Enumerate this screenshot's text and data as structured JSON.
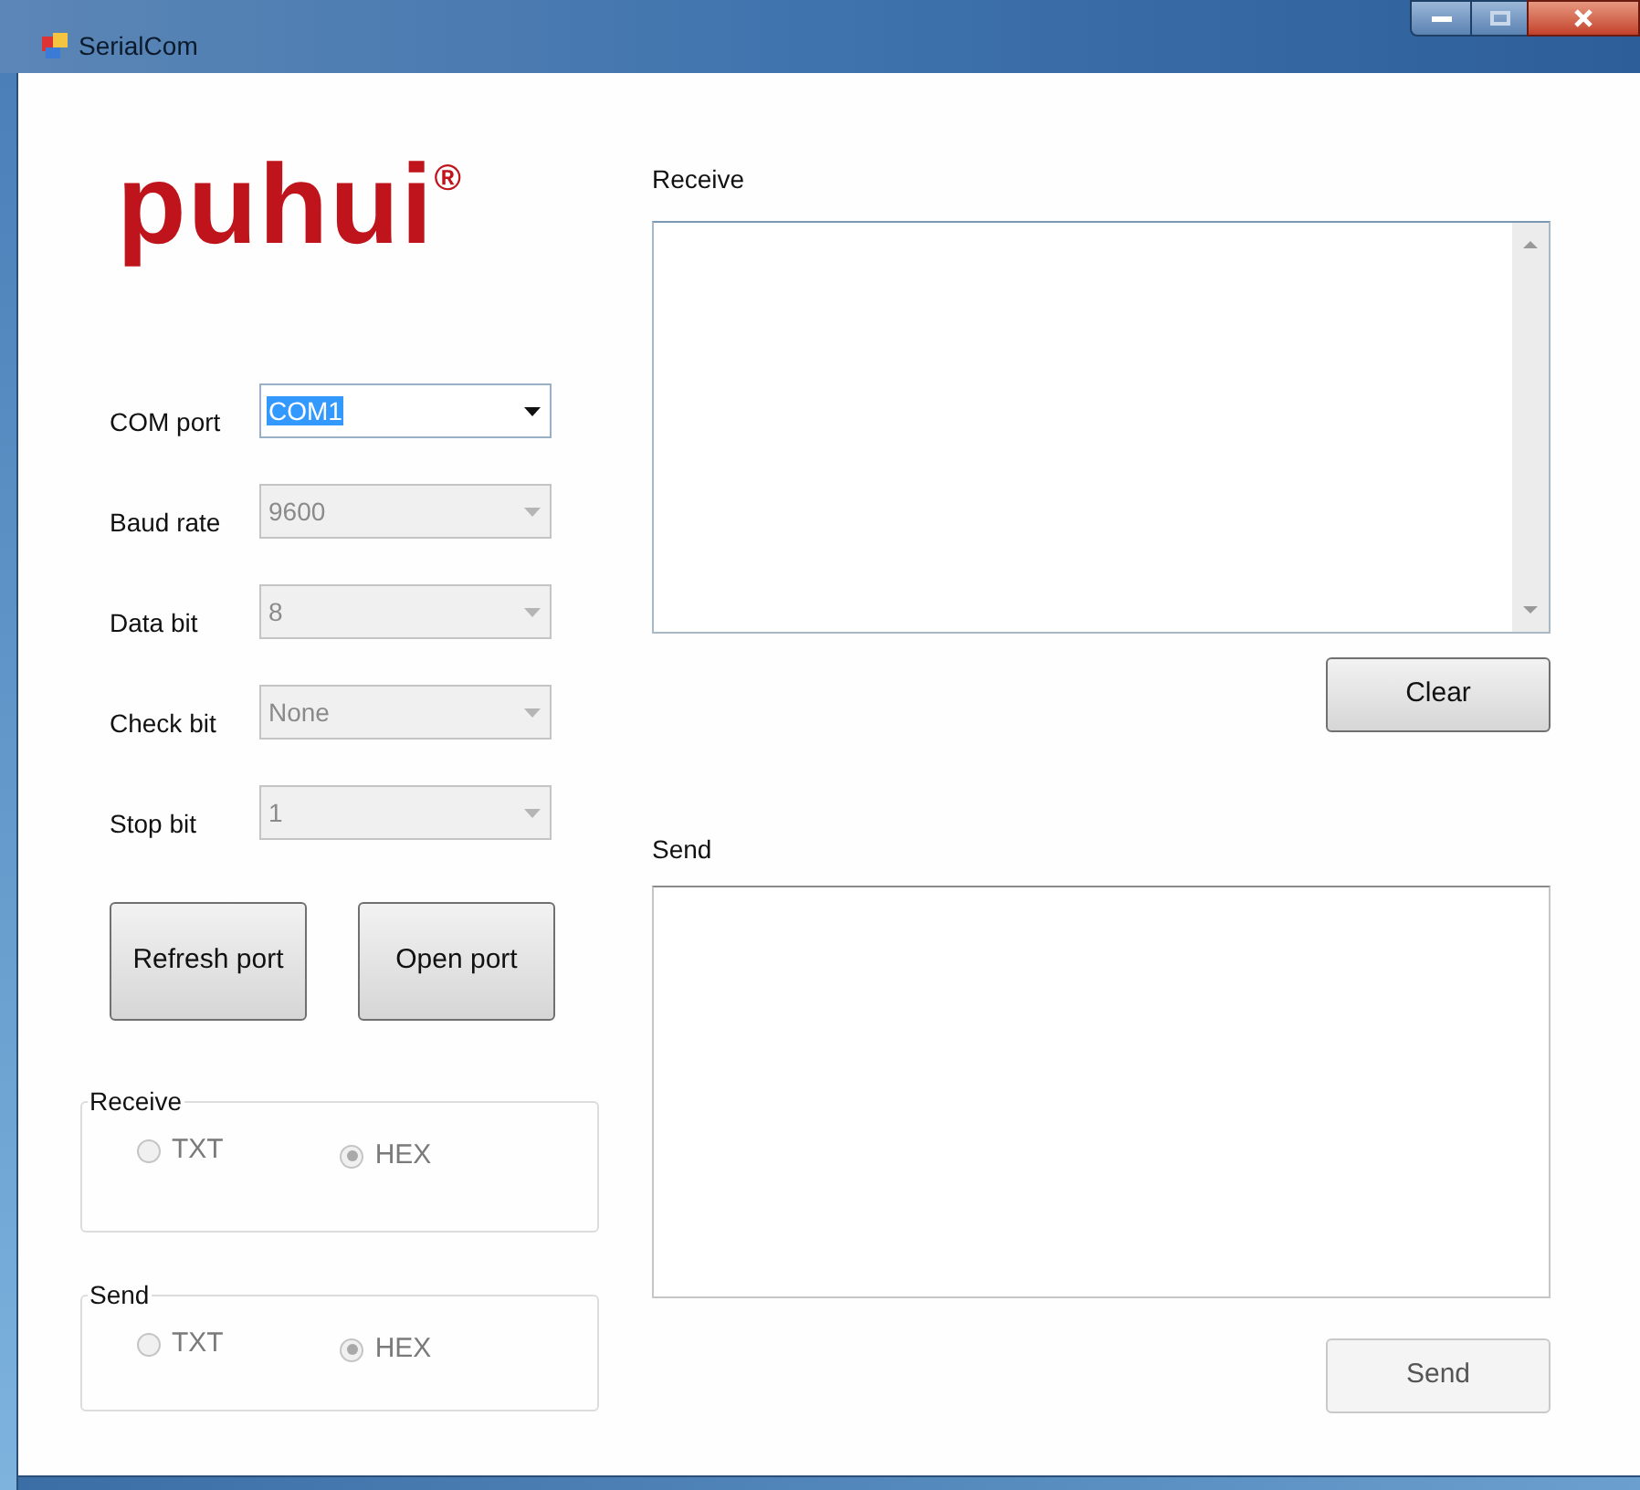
{
  "window": {
    "title": "SerialCom"
  },
  "logo": {
    "text": "puhui",
    "mark": "®"
  },
  "settings": [
    {
      "label": "COM port",
      "value": "COM1",
      "disabled": false,
      "highlighted": true
    },
    {
      "label": "Baud rate",
      "value": "9600",
      "disabled": true,
      "highlighted": false
    },
    {
      "label": "Data bit",
      "value": "8",
      "disabled": true,
      "highlighted": false
    },
    {
      "label": "Check bit",
      "value": "None",
      "disabled": true,
      "highlighted": false
    },
    {
      "label": "Stop bit",
      "value": "1",
      "disabled": true,
      "highlighted": false
    }
  ],
  "port_buttons": [
    {
      "label": "Refresh port",
      "disabled": false
    },
    {
      "label": "Open port",
      "disabled": false
    }
  ],
  "format_groups": [
    {
      "title": "Receive",
      "options": [
        {
          "label": "TXT",
          "selected": false,
          "disabled": true
        },
        {
          "label": "HEX",
          "selected": true,
          "disabled": true
        }
      ]
    },
    {
      "title": "Send",
      "options": [
        {
          "label": "TXT",
          "selected": false,
          "disabled": true
        },
        {
          "label": "HEX",
          "selected": true,
          "disabled": true
        }
      ]
    }
  ],
  "receive": {
    "label": "Receive",
    "button": {
      "label": "Clear",
      "disabled": false
    }
  },
  "send": {
    "label": "Send",
    "button": {
      "label": "Send",
      "disabled": true
    }
  }
}
